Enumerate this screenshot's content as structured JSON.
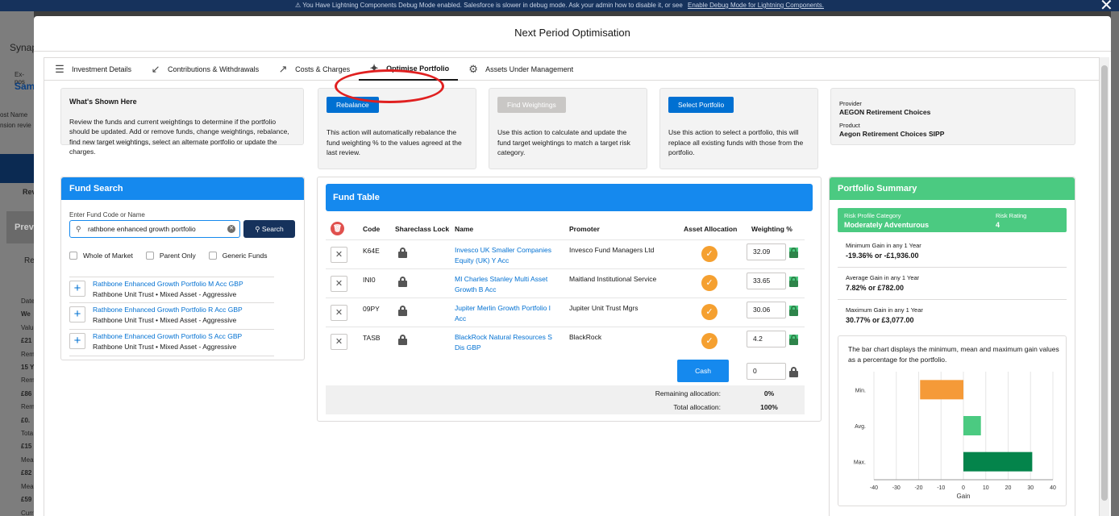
{
  "banner": {
    "text": "You Have Lightning Components Debug Mode enabled. Salesforce is slower in debug mode. Ask your admin how to disable it, or see",
    "link": "Enable Debug Mode for Lightning Components."
  },
  "background": {
    "app_name": "Synap",
    "record_label": "Ex-pos",
    "record_name": "Sam",
    "post_name": "ost Name",
    "pension": "nsion revie",
    "rev": "Rev",
    "prev": "Prev",
    "re": "Re",
    "vals": [
      "Date",
      "We",
      "Valu",
      "£21",
      "Rem",
      "15 Y",
      "Rem",
      "£86",
      "Rem",
      "£0.",
      "Tota",
      "£15",
      "Mea",
      "£82",
      "Mea",
      "£59",
      "Curr"
    ]
  },
  "modal": {
    "title": "Next Period Optimisation"
  },
  "tabs": [
    {
      "label": "Investment Details",
      "icon": "list-icon"
    },
    {
      "label": "Contributions & Withdrawals",
      "icon": "contract-arrows-icon"
    },
    {
      "label": "Costs & Charges",
      "icon": "expand-arrows-icon"
    },
    {
      "label": "Optimise Portfolio",
      "icon": "magic-wand-icon",
      "active": true
    },
    {
      "label": "Assets Under Management",
      "icon": "gear-icon"
    }
  ],
  "whats_shown": {
    "title": "What's Shown Here",
    "text": "Review the funds and current weightings to determine if the portfolio should be updated. Add or remove funds, change weightings, rebalance, find new target weightings, select an alternate portfolio or update the charges."
  },
  "actions": [
    {
      "button": "Rebalance",
      "text": "This action will automatically rebalance the fund weighting % to the values agreed at the last review.",
      "disabled": false
    },
    {
      "button": "Find Weightings",
      "text": "Use this action to calculate and update the fund target weightings to match a target risk category.",
      "disabled": true
    },
    {
      "button": "Select Portfolio",
      "text": "Use this action to select a portfolio, this will replace all existing funds with those from the portfolio.",
      "disabled": false
    }
  ],
  "provider": {
    "provider_label": "Provider",
    "provider_value": "AEGON Retirement Choices",
    "product_label": "Product",
    "product_value": "Aegon Retirement Choices SIPP"
  },
  "fund_search": {
    "title": "Fund Search",
    "input_label": "Enter Fund Code or Name",
    "input_value": "rathbone enhanced growth portfolio",
    "search_button": "Search",
    "filters": [
      "Whole of Market",
      "Parent Only",
      "Generic Funds"
    ],
    "results": [
      {
        "name": "Rathbone Enhanced Growth Portfolio M Acc GBP",
        "sub": "Rathbone Unit Trust • Mixed Asset - Aggressive"
      },
      {
        "name": "Rathbone Enhanced Growth Portfolio R Acc GBP",
        "sub": "Rathbone Unit Trust • Mixed Asset - Aggressive"
      },
      {
        "name": "Rathbone Enhanced Growth Portfolio S Acc GBP",
        "sub": "Rathbone Unit Trust • Mixed Asset - Aggressive"
      }
    ]
  },
  "fund_table": {
    "title": "Fund Table",
    "columns": [
      "Code",
      "Shareclass Lock",
      "Name",
      "Promoter",
      "Asset Allocation",
      "Weighting %"
    ],
    "rows": [
      {
        "code": "K64E",
        "name": "Invesco UK Smaller Companies Equity (UK) Y Acc",
        "promoter": "Invesco Fund Managers Ltd",
        "weighting": "32.09"
      },
      {
        "code": "INI0",
        "name": "MI Charles Stanley Multi Asset Growth B Acc",
        "promoter": "Maitland Institutional Service",
        "weighting": "33.65"
      },
      {
        "code": "09PY",
        "name": "Jupiter Merlin Growth Portfolio I Acc",
        "promoter": "Jupiter Unit Trust Mgrs",
        "weighting": "30.06"
      },
      {
        "code": "TASB",
        "name": "BlackRock Natural Resources S Dis GBP",
        "promoter": "BlackRock",
        "weighting": "4.2"
      }
    ],
    "cash_button": "Cash",
    "cash_value": "0",
    "remaining_label": "Remaining allocation:",
    "remaining_value": "0%",
    "total_label": "Total allocation:",
    "total_value": "100%"
  },
  "portfolio_summary": {
    "title": "Portfolio Summary",
    "risk_profile_label": "Risk Profile Category",
    "risk_profile_value": "Moderately Adventurous",
    "risk_rating_label": "Risk Rating",
    "risk_rating_value": "4",
    "min_label": "Minimum Gain in any 1 Year",
    "min_value": "-19.36% or -£1,936.00",
    "avg_label": "Average Gain in any 1 Year",
    "avg_value": "7.82% or £782.00",
    "max_label": "Maximum Gain in any 1 Year",
    "max_value": "30.77% or £3,077.00",
    "chart_description": "The bar chart displays the minimum, mean and maximum gain values as a percentage for the portfolio."
  },
  "colors": {
    "brand_blue": "#1589ee",
    "summary_green": "#4bca81",
    "min_bar": "#f59a38",
    "avg_bar": "#4bca81",
    "max_bar": "#04844b"
  },
  "chart_data": {
    "type": "bar",
    "orientation": "horizontal",
    "categories": [
      "Min.",
      "Avg.",
      "Max."
    ],
    "values": [
      -19.36,
      7.82,
      30.77
    ],
    "xlabel": "Gain",
    "xlim": [
      -40,
      40
    ],
    "xticks": [
      -40,
      -30,
      -20,
      -10,
      0,
      10,
      20,
      30,
      40
    ],
    "grid": true
  }
}
